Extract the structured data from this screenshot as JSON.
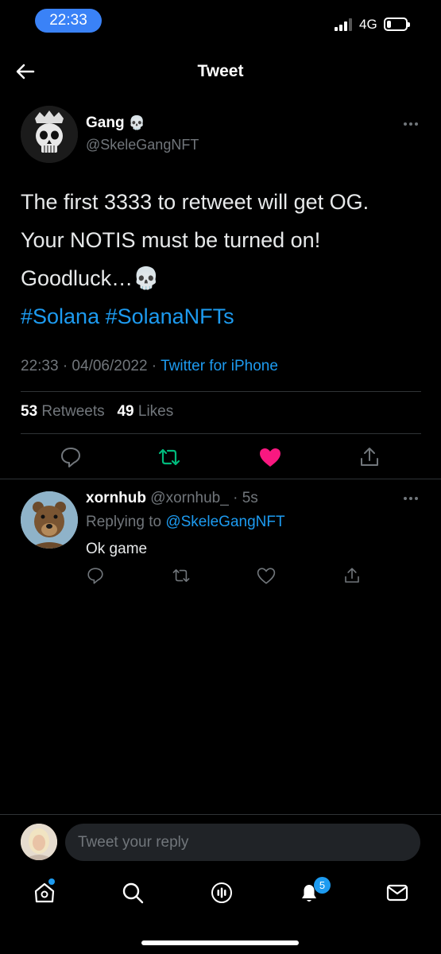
{
  "status_bar": {
    "time": "22:33",
    "network": "4G"
  },
  "header": {
    "title": "Tweet"
  },
  "tweet": {
    "author_name": "Gang",
    "author_emoji": "💀",
    "author_handle": "@SkeleGangNFT",
    "text_lines": [
      "The first 3333 to retweet will get OG.",
      "Your NOTIS must be turned on!",
      "Goodluck…💀"
    ],
    "hashtags": "#Solana #SolanaNFTs",
    "timestamp": "22:33 · 04/06/2022",
    "separator": " · ",
    "source": "Twitter for iPhone",
    "retweets_count": "53",
    "retweets_label": "Retweets",
    "likes_count": "49",
    "likes_label": "Likes",
    "liked": true
  },
  "reply": {
    "author_name": "xornhub",
    "author_handle": "@xornhub_",
    "time": "· 5s",
    "replying_prefix": "Replying to",
    "replying_to": "@SkeleGangNFT",
    "text": "Ok game"
  },
  "compose": {
    "placeholder": "Tweet your reply"
  },
  "nav": {
    "notifications_badge": "5"
  },
  "colors": {
    "accent": "#1d9bf0",
    "like": "#f91880",
    "retweet": "#00ba7c",
    "status_pill": "#3a82f7"
  }
}
